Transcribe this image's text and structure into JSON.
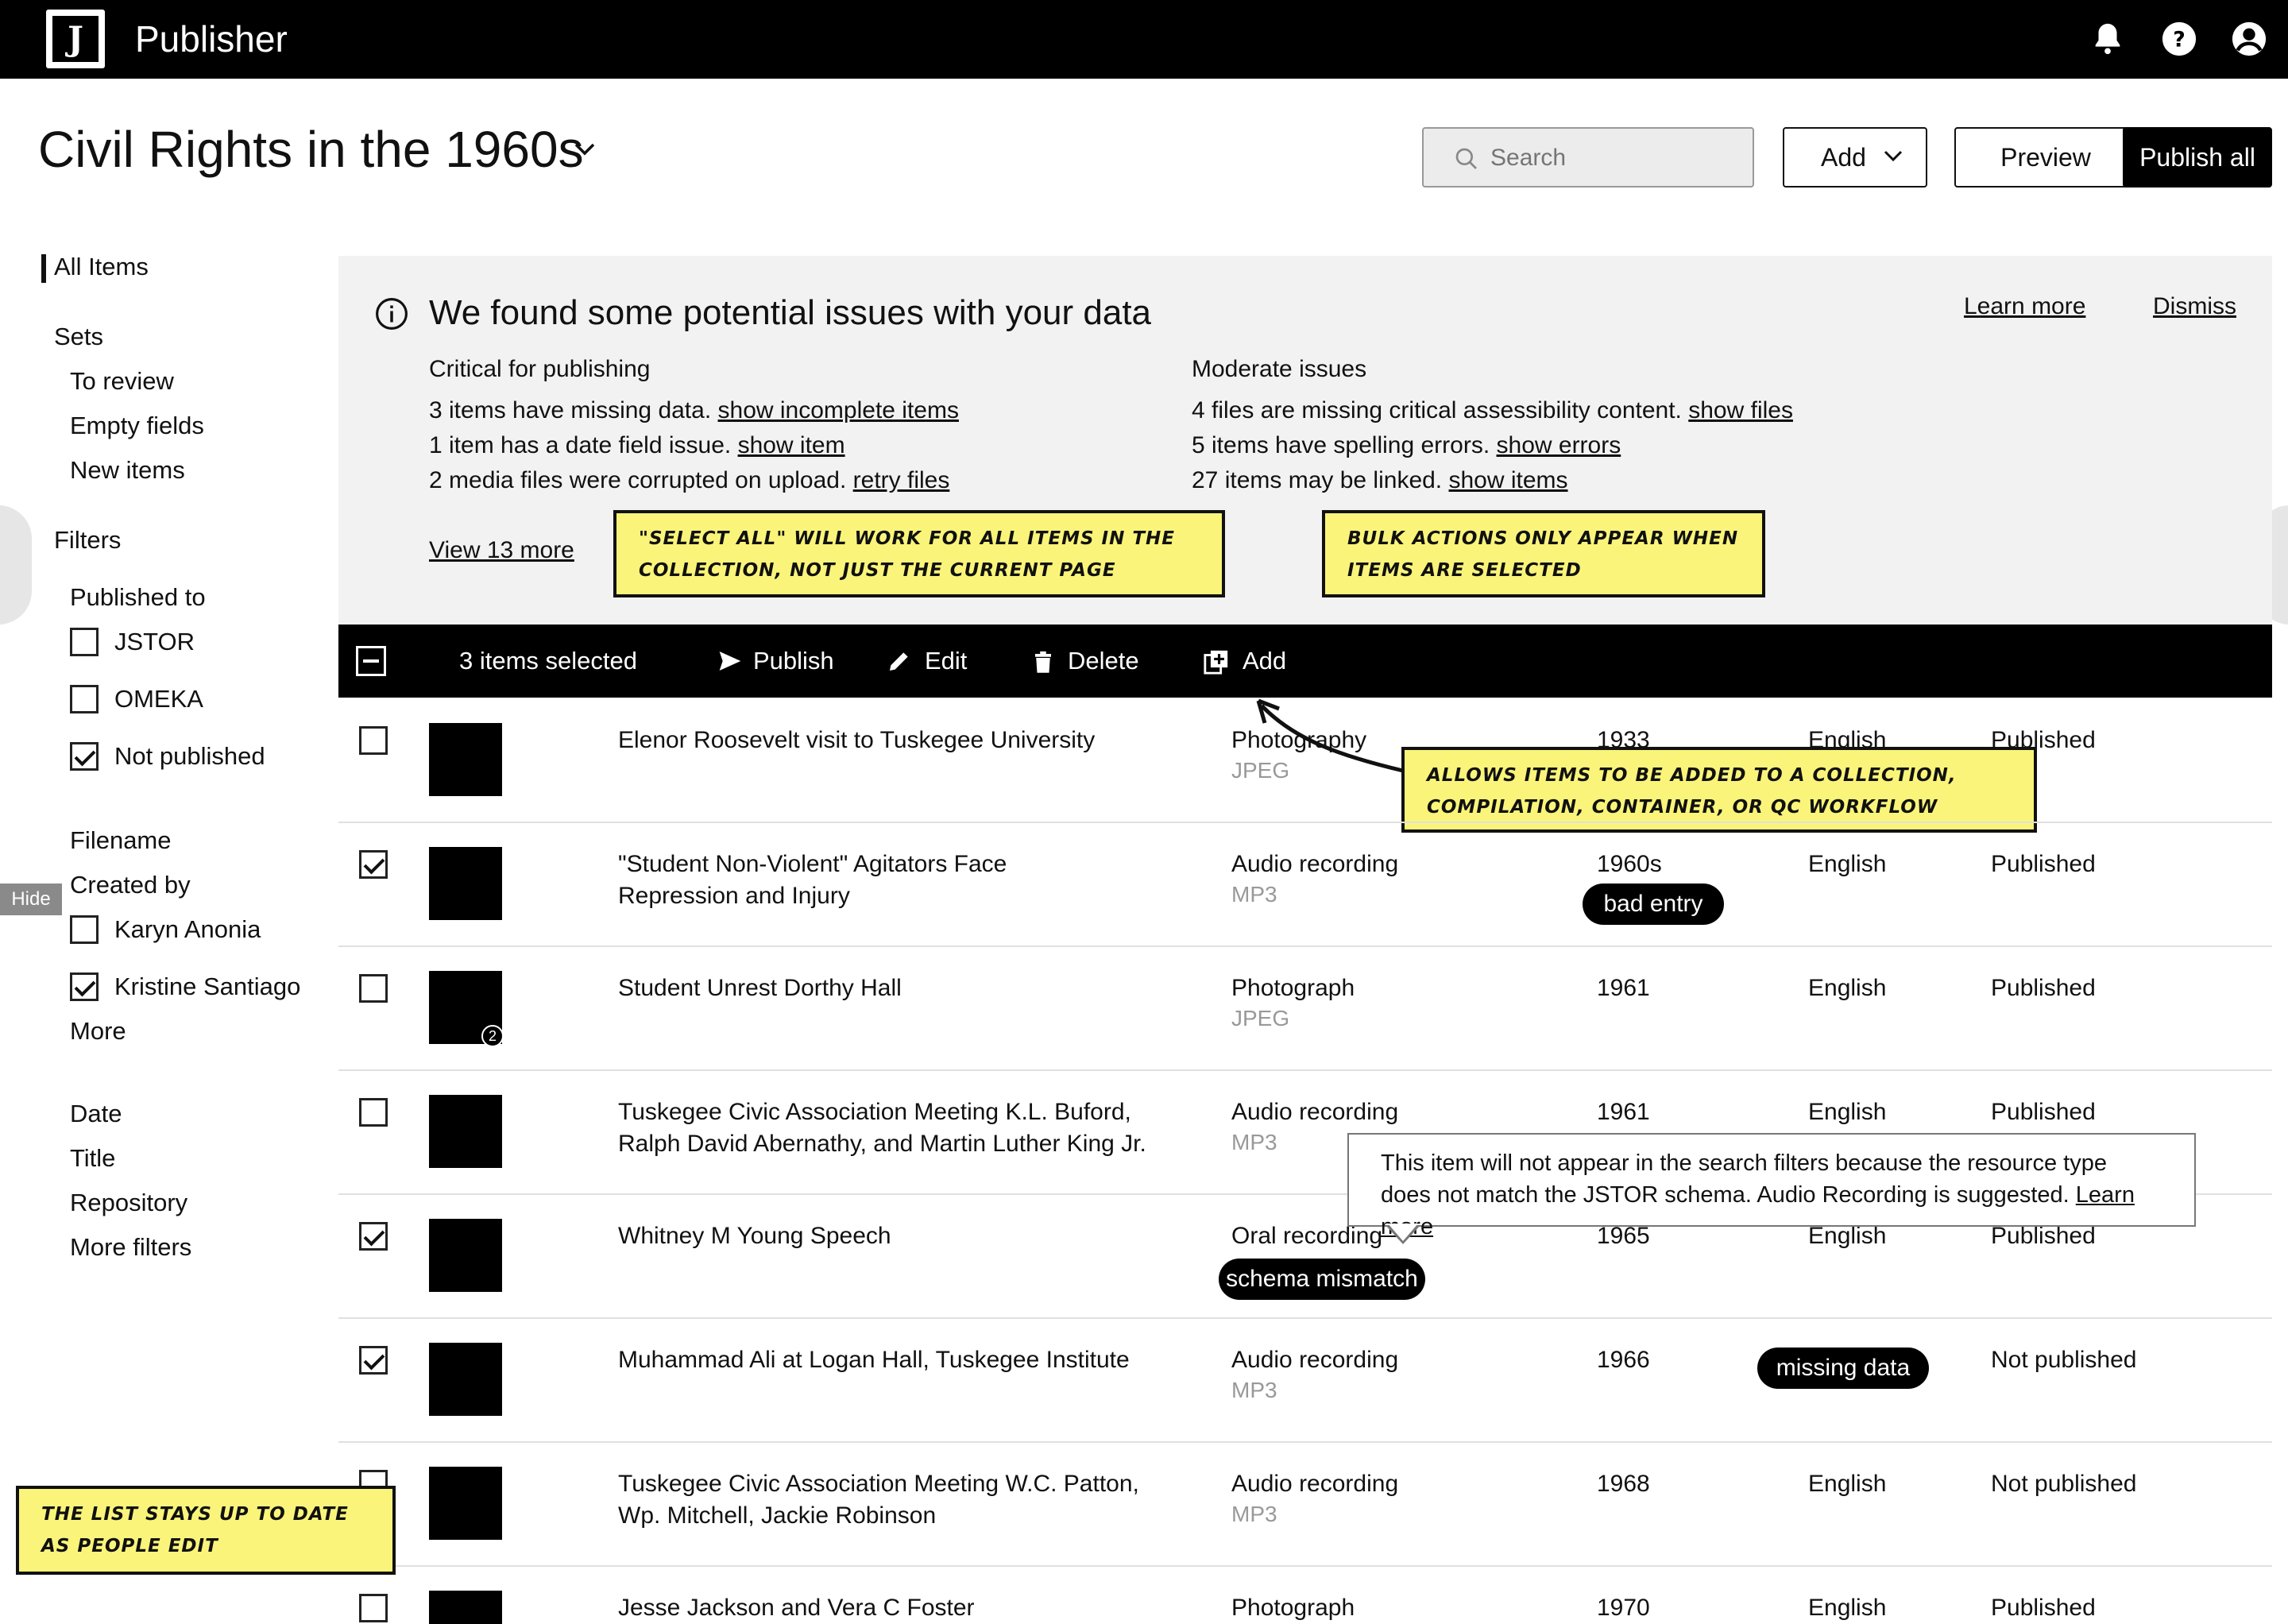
{
  "app": {
    "title": "Publisher"
  },
  "header": {
    "page_title": "Civil Rights in the 1960s",
    "search_placeholder": "Search",
    "add_label": "Add",
    "preview_label": "Preview",
    "publish_all_label": "Publish all"
  },
  "sidebar": {
    "all_items": "All Items",
    "sets_heading": "Sets",
    "sets": [
      "To review",
      "Empty fields",
      "New items"
    ],
    "filters_heading": "Filters",
    "published_to_heading": "Published to",
    "published_to": [
      {
        "label": "JSTOR",
        "checked": false
      },
      {
        "label": "OMEKA",
        "checked": false
      },
      {
        "label": "Not published",
        "checked": true
      }
    ],
    "filename": "Filename",
    "created_by_heading": "Created by",
    "created_by": [
      {
        "label": "Karyn Anonia",
        "checked": false
      },
      {
        "label": "Kristine Santiago",
        "checked": true
      }
    ],
    "more": "More",
    "fields": [
      "Date",
      "Title",
      "Repository",
      "More filters"
    ],
    "hide_label": "Hide"
  },
  "issues": {
    "title": "We found some potential issues with your data",
    "learn_more": "Learn more",
    "dismiss": "Dismiss",
    "critical_heading": "Critical for publishing",
    "critical": [
      {
        "text": "3 items have missing data.",
        "link": "show incomplete items"
      },
      {
        "text": "1 item has a date field issue.",
        "link": "show item"
      },
      {
        "text": "2 media files were corrupted on upload.",
        "link": "retry files"
      }
    ],
    "moderate_heading": "Moderate issues",
    "moderate": [
      {
        "text": "4 files are missing critical assessibility content.",
        "link": "show files"
      },
      {
        "text": "5 items have spelling errors.",
        "link": "show errors"
      },
      {
        "text": "27 items may be linked.",
        "link": "show items"
      }
    ],
    "view_more": "View 13 more"
  },
  "notes": {
    "select_all": "\"Select all\" will work for all items in the collection, not just the current page",
    "bulk_actions": "Bulk actions only appear when items are selected",
    "allows_items": "Allows items to be added to a collection, compilation, container, or QC workflow",
    "list_up_to_date": "The list stays up to date as people edit"
  },
  "bulk_bar": {
    "selected_count": "3 items selected",
    "publish": "Publish",
    "edit": "Edit",
    "delete": "Delete",
    "add": "Add"
  },
  "rows": [
    {
      "checked": false,
      "title": "Elenor Roosevelt visit to Tuskegee University",
      "type": "Photography",
      "format": "JPEG",
      "date": "1933",
      "language": "English",
      "status": "Published"
    },
    {
      "checked": true,
      "title": "\"Student Non-Violent\" Agitators Face Repression and Injury",
      "type": "Audio recording",
      "format": "MP3",
      "date": "1960s",
      "date_badge": "bad entry",
      "language": "English",
      "status": "Published"
    },
    {
      "checked": false,
      "title": "Student Unrest Dorthy Hall",
      "type": "Photograph",
      "format": "JPEG",
      "date": "1961",
      "language": "English",
      "status": "Published",
      "thumb_count": "2"
    },
    {
      "checked": false,
      "title": "Tuskegee Civic Association Meeting K.L. Buford, Ralph David Abernathy, and Martin Luther King Jr.",
      "type": "Audio recording",
      "format": "MP3",
      "date": "1961",
      "language": "English",
      "status": "Published"
    },
    {
      "checked": true,
      "title": "Whitney M Young Speech",
      "type": "Oral recording",
      "type_badge": "schema mismatch",
      "format": "",
      "date": "1965",
      "language": "English",
      "status": "Published"
    },
    {
      "checked": true,
      "title": "Muhammad Ali at Logan Hall, Tuskegee Institute",
      "type": "Audio recording",
      "format": "MP3",
      "date": "1966",
      "language_badge": "missing data",
      "status": "Not published"
    },
    {
      "checked": false,
      "title": "Tuskegee Civic Association Meeting W.C. Patton, Wp. Mitchell, Jackie Robinson",
      "type": "Audio recording",
      "format": "MP3",
      "date": "1968",
      "language": "English",
      "status": "Not published"
    },
    {
      "checked": false,
      "title": "Jesse Jackson and Vera C Foster",
      "type": "Photograph",
      "format": "",
      "date": "1970",
      "language": "English",
      "status": "Published"
    }
  ],
  "tooltip": {
    "text": "This item will not appear in the search filters because the resource type does not match the JSTOR schema. Audio Recording is suggested.",
    "link": "Learn more"
  }
}
